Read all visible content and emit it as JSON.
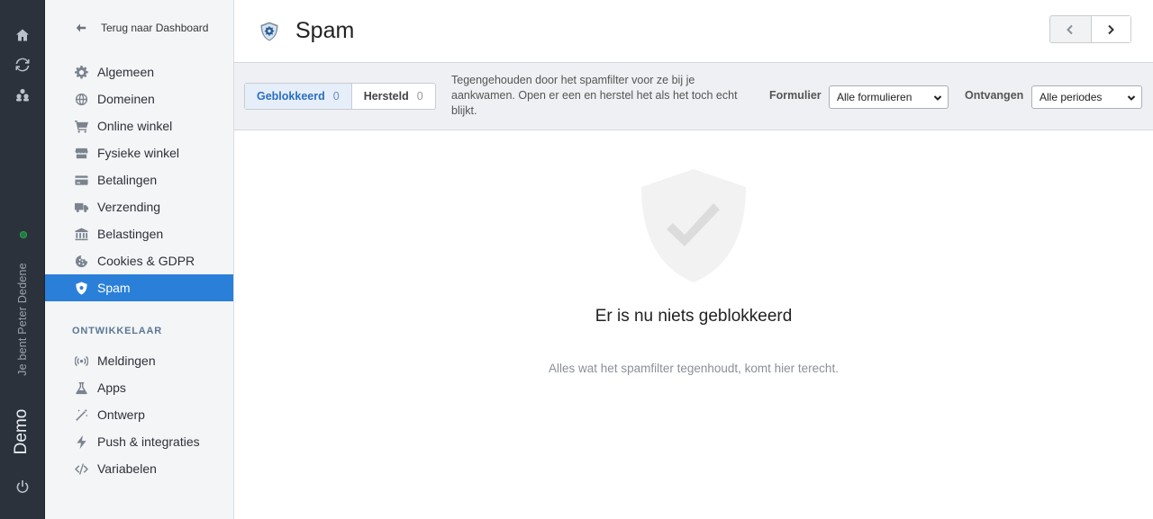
{
  "rail": {
    "user_label": "Je bent Peter Dedene",
    "store_name": "Demo"
  },
  "sidebar": {
    "back_label": "Terug naar Dashboard",
    "items": [
      {
        "label": "Algemeen",
        "icon": "gear-icon"
      },
      {
        "label": "Domeinen",
        "icon": "globe-icon"
      },
      {
        "label": "Online winkel",
        "icon": "cart-icon"
      },
      {
        "label": "Fysieke winkel",
        "icon": "store-icon"
      },
      {
        "label": "Betalingen",
        "icon": "credit-card-icon"
      },
      {
        "label": "Verzending",
        "icon": "truck-icon"
      },
      {
        "label": "Belastingen",
        "icon": "bank-icon"
      },
      {
        "label": "Cookies & GDPR",
        "icon": "cookie-icon"
      },
      {
        "label": "Spam",
        "icon": "shield-icon",
        "active": true
      }
    ],
    "dev_section_label": "ONTWIKKELAAR",
    "dev_items": [
      {
        "label": "Meldingen",
        "icon": "broadcast-icon"
      },
      {
        "label": "Apps",
        "icon": "flask-icon"
      },
      {
        "label": "Ontwerp",
        "icon": "magic-wand-icon"
      },
      {
        "label": "Push & integraties",
        "icon": "bolt-icon"
      },
      {
        "label": "Variabelen",
        "icon": "code-icon"
      }
    ]
  },
  "header": {
    "title": "Spam"
  },
  "filters": {
    "tabs": [
      {
        "label": "Geblokkeerd",
        "count": "0",
        "active": true
      },
      {
        "label": "Hersteld",
        "count": "0",
        "active": false
      }
    ],
    "description": "Tegengehouden door het spamfilter voor ze bij je aankwamen. Open er een en herstel het als het toch echt blijkt.",
    "form_label": "Formulier",
    "form_value": "Alle formulieren",
    "received_label": "Ontvangen",
    "received_value": "Alle periodes"
  },
  "empty_state": {
    "title": "Er is nu niets geblokkeerd",
    "subtitle": "Alles wat het spamfilter tegenhoudt, komt hier terecht."
  },
  "colors": {
    "accent": "#2a80d8",
    "rail_bg": "#2b323b",
    "status_dot": "#1f7a3c"
  }
}
